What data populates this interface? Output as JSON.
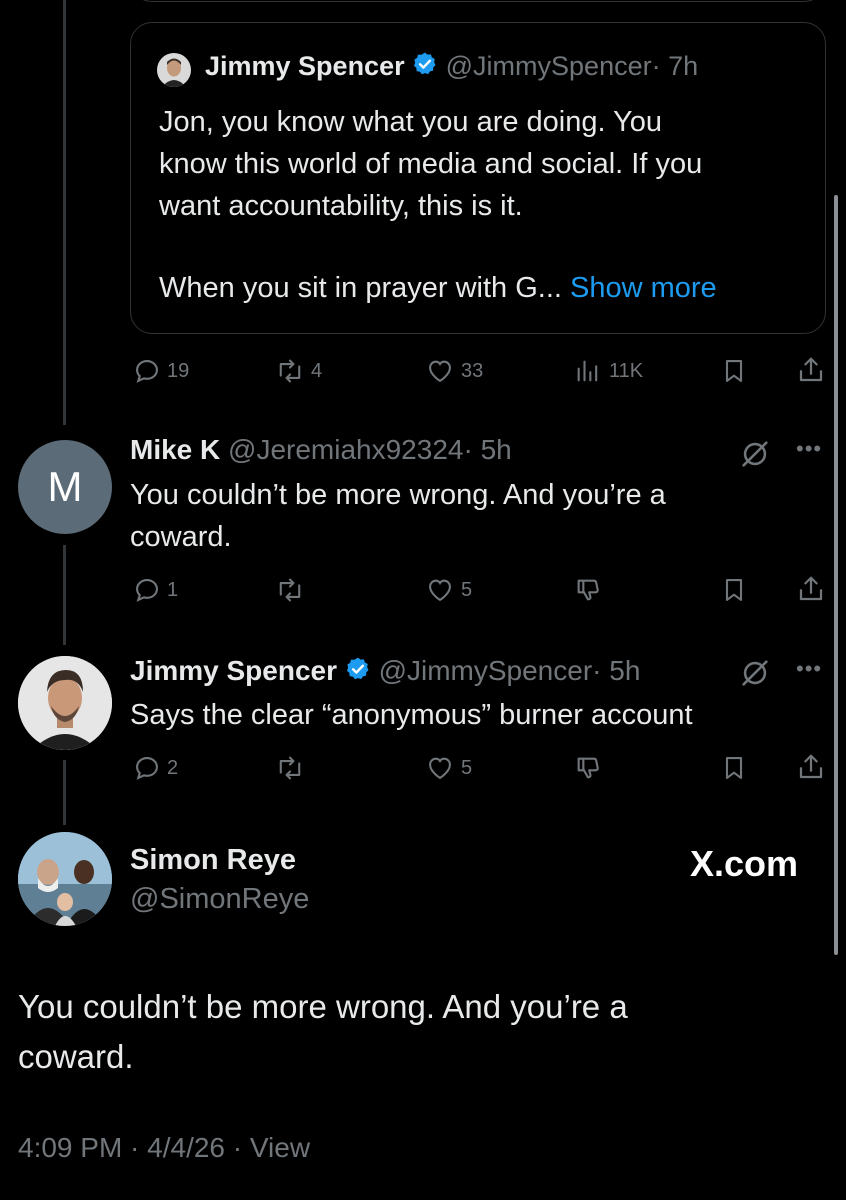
{
  "quoted_tweet": {
    "name": "Jimmy Spencer",
    "handle": "@JimmySpencer",
    "time": "· 7h",
    "line1": "Jon, you know what you are doing. You",
    "line2": "know this world of media and social. If you",
    "line3": "want accountability, this is it.",
    "line4": "When you sit in prayer with G...",
    "show_more": "Show more"
  },
  "quoted_actions": {
    "replies": "19",
    "reposts": "4",
    "likes": "33",
    "views": "11K"
  },
  "reply1": {
    "avatar_letter": "M",
    "name": "Mike K",
    "handle": "@Jeremiahx92324",
    "time": "· 5h",
    "line1": "You couldn’t be more wrong.  And you’re a",
    "line2": "coward.",
    "actions": {
      "replies": "1",
      "reposts": "",
      "likes": "5"
    }
  },
  "reply2": {
    "name": "Jimmy Spencer",
    "handle": "@JimmySpencer",
    "time": "· 5h",
    "line1": "Says the clear “anonymous” burner account",
    "actions": {
      "replies": "2",
      "reposts": "",
      "likes": "5"
    }
  },
  "focus_tweet": {
    "name": "Simon Reye",
    "handle": "@SimonReye",
    "watermark": "X.com",
    "line1": "You couldn’t be more wrong.  And you’re a",
    "line2": "coward.",
    "meta": "4:09 PM · 4/4/26 · View"
  },
  "colors": {
    "background": "#000000",
    "text": "#e7e9ea",
    "muted": "#71767b",
    "link": "#1d9bf0",
    "verified": "#1d9bf0",
    "border": "#2f3336"
  }
}
